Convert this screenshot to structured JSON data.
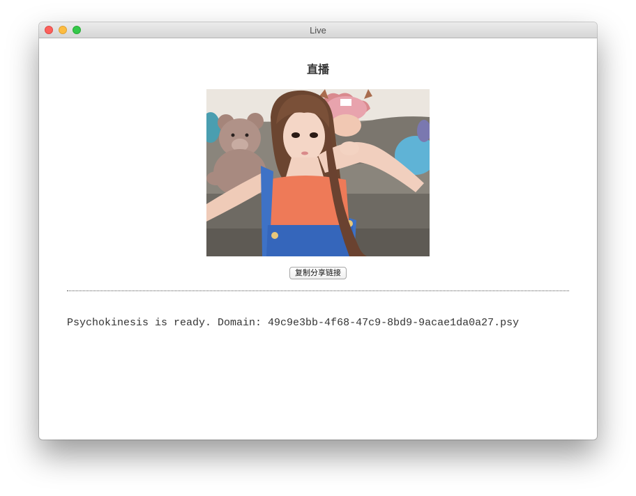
{
  "window": {
    "title": "Live"
  },
  "page": {
    "heading": "直播",
    "photo_description": "live stream preview image",
    "copy_button_label": "复制分享链接",
    "status_text": "Psychokinesis is ready. Domain: 49c9e3bb-4f68-47c9-8bd9-9acae1da0a27.psy"
  },
  "colors": {
    "close": "#fc605c",
    "minimize": "#fdbc40",
    "maximize": "#34c84a"
  }
}
